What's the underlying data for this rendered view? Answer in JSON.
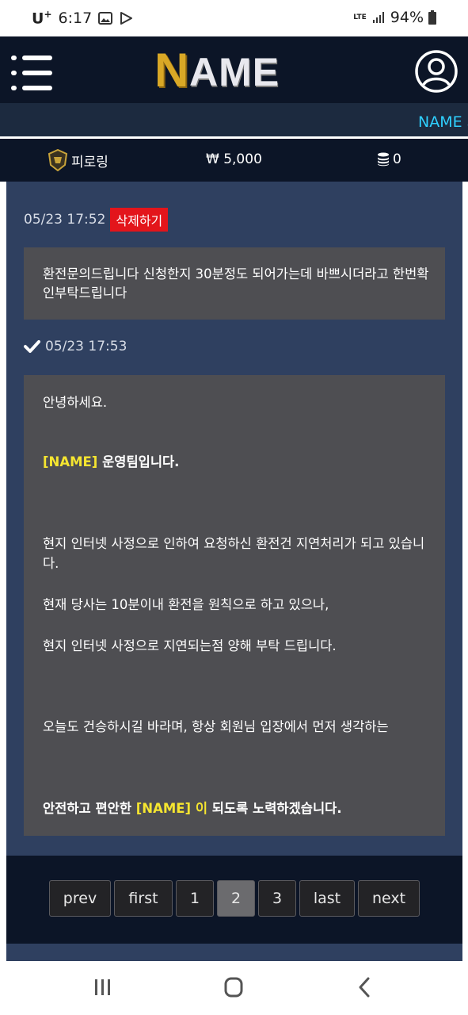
{
  "status_bar": {
    "carrier": "U",
    "carrier_sup": "+",
    "time": "6:17",
    "network": "LTE",
    "battery": "94%"
  },
  "header": {
    "logo_first": "N",
    "logo_rest": "AME",
    "menu_icon": "hamburger-menu-icon",
    "user_icon": "user-account-icon"
  },
  "marquee": {
    "text": "NAME 회"
  },
  "user_info": {
    "level_name": "피로링",
    "money": "₩ 5,000",
    "points": "0"
  },
  "question": {
    "date": "05/23 17:52",
    "delete_label": "삭제하기",
    "body": "환전문의드립니다 신청한지 30분정도 되어가는데 바쁘시더라고 한번확인부탁드립니다"
  },
  "answer": {
    "date": "05/23 17:53",
    "greeting": "안녕하세요.",
    "team_brand": "[NAME]",
    "team_suffix": " 운영팀입니다.",
    "line1": "현지 인터넷 사정으로 인하여 요청하신 환전건 지연처리가 되고 있습니다.",
    "line2": "현재 당사는 10분이내 환전을 원칙으로 하고 있으나,",
    "line3": "현지 인터넷 사정으로 지연되는점 양해 부탁 드립니다.",
    "line4": "오늘도 건승하시길 바라며, 항상 회원님 입장에서 먼저 생각하는",
    "closing_pre": "안전하고 편안한 ",
    "closing_brand": "[NAME] 이",
    "closing_post": " 되도록 노력하겠습니다."
  },
  "pagination": {
    "prev": "prev",
    "first": "first",
    "pages": [
      "1",
      "2",
      "3"
    ],
    "current": "2",
    "last": "last",
    "next": "next"
  },
  "colors": {
    "header_bg": "#0c1527",
    "content_bg": "#2f4060",
    "box_bg": "#4e4e52",
    "delete_red": "#e3151b",
    "highlight_yellow": "#f5e530",
    "marquee_cyan": "#2fd0ff"
  }
}
